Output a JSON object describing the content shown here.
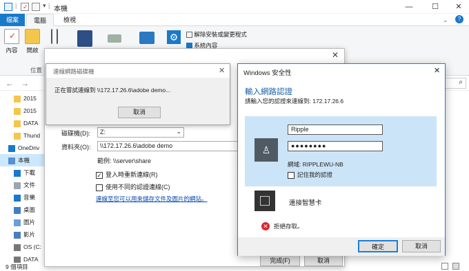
{
  "explorer": {
    "title": "本機",
    "caption_close_glyph": "✕",
    "tabs": {
      "file": "檔案",
      "computer": "電腦",
      "view": "檢視"
    },
    "ribbon": {
      "properties": "內容",
      "open": "開啟",
      "uninstall": "解除安裝或變更程式",
      "system_properties": "系統內容",
      "group_location": "位置"
    },
    "sidebar": [
      {
        "label": "2015",
        "icon": "folder-icon"
      },
      {
        "label": "2015",
        "icon": "folder-icon"
      },
      {
        "label": "DATA",
        "icon": "folder-icon"
      },
      {
        "label": "Thund",
        "icon": "folder-icon"
      },
      {
        "label": "OneDriv",
        "icon": "cloud-icon"
      },
      {
        "label": "本機",
        "icon": "computer-icon"
      },
      {
        "label": "下載",
        "icon": "download-icon"
      },
      {
        "label": "文件",
        "icon": "document-icon"
      },
      {
        "label": "音樂",
        "icon": "music-icon"
      },
      {
        "label": "桌面",
        "icon": "desktop-icon"
      },
      {
        "label": "圖片",
        "icon": "pictures-icon"
      },
      {
        "label": "影片",
        "icon": "video-icon"
      },
      {
        "label": "OS (C:",
        "icon": "drive-icon"
      },
      {
        "label": "DATA",
        "icon": "drive-icon"
      }
    ],
    "status": "9 個項目"
  },
  "map_drive": {
    "drive_label": "磁碟機(D):",
    "drive_value": "Z:",
    "folder_label": "資料夾(O):",
    "folder_value": "\\\\172.17.26.6\\adobe demo",
    "example": "範例: \\\\server\\share",
    "reconnect_label": "登入時重新連線(R)",
    "reconnect_checked": true,
    "diff_creds_label": "使用不同的認證連線(C)",
    "diff_creds_checked": false,
    "link_text": "連線至您可以用來儲存文件及圖片的網站。",
    "finish_label": "完成(F)",
    "cancel_label": "取消"
  },
  "connecting": {
    "title": "連線網路磁碟機",
    "message": "正在嘗試連線到 \\\\172.17.26.6\\adobe demo...",
    "cancel_label": "取消"
  },
  "security": {
    "window_title": "Windows 安全性",
    "heading": "輸入網路認證",
    "subtitle": "請輸入您的認證來連線到: 172.17.26.6",
    "username": "Ripple",
    "password": "●●●●●●●●",
    "domain": "網域: RIPPLEWU-NB",
    "remember_label": "記住我的認證",
    "remember_checked": false,
    "smartcard_label": "連接智慧卡",
    "error_text": "拒絕存取。",
    "ok_label": "確定",
    "cancel_label": "取消",
    "accent_color": "#1c7ed6"
  }
}
